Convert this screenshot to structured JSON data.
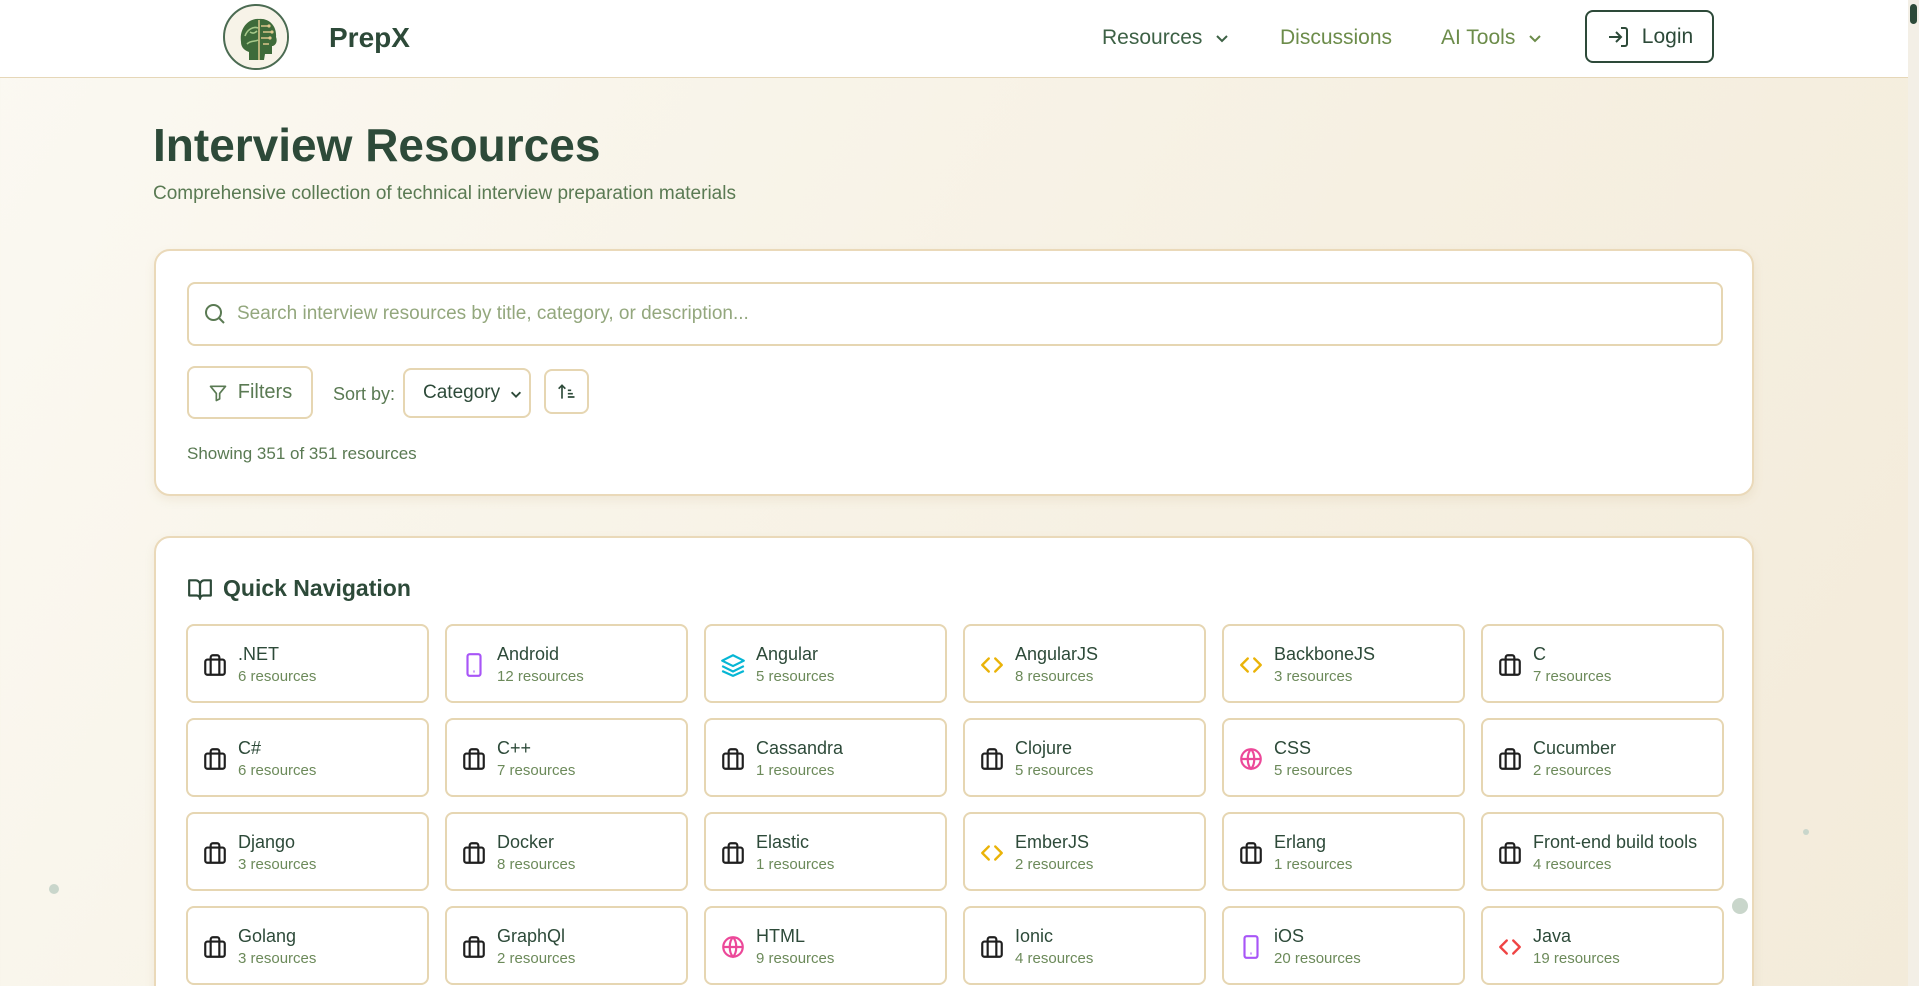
{
  "header": {
    "brand": "PrepX",
    "nav": [
      {
        "label": "Resources",
        "dropdown": true
      },
      {
        "label": "Discussions",
        "dropdown": false
      },
      {
        "label": "AI Tools",
        "dropdown": true
      }
    ],
    "login_label": "Login"
  },
  "page": {
    "title": "Interview Resources",
    "subtitle": "Comprehensive collection of technical interview preparation materials"
  },
  "search": {
    "placeholder": "Search interview resources by title, category, or description...",
    "value": "",
    "filters_label": "Filters",
    "sort_label": "Sort by:",
    "sort_value": "Category",
    "showing": "Showing 351 of 351 resources"
  },
  "quick_nav": {
    "title": "Quick Navigation",
    "items": [
      {
        "name": ".NET",
        "count": "6 resources",
        "icon": "briefcase-icon",
        "color": "#1f1f1f"
      },
      {
        "name": "Android",
        "count": "12 resources",
        "icon": "smartphone-icon",
        "color": "#a855f7"
      },
      {
        "name": "Angular",
        "count": "5 resources",
        "icon": "layers-icon",
        "color": "#06b6d4"
      },
      {
        "name": "AngularJS",
        "count": "8 resources",
        "icon": "code-icon",
        "color": "#eab308"
      },
      {
        "name": "BackboneJS",
        "count": "3 resources",
        "icon": "code-icon",
        "color": "#eab308"
      },
      {
        "name": "C",
        "count": "7 resources",
        "icon": "briefcase-icon",
        "color": "#1f1f1f"
      },
      {
        "name": "C#",
        "count": "6 resources",
        "icon": "briefcase-icon",
        "color": "#1f1f1f"
      },
      {
        "name": "C++",
        "count": "7 resources",
        "icon": "briefcase-icon",
        "color": "#1f1f1f"
      },
      {
        "name": "Cassandra",
        "count": "1 resources",
        "icon": "briefcase-icon",
        "color": "#1f1f1f"
      },
      {
        "name": "Clojure",
        "count": "5 resources",
        "icon": "briefcase-icon",
        "color": "#1f1f1f"
      },
      {
        "name": "CSS",
        "count": "5 resources",
        "icon": "globe-icon",
        "color": "#ec4899"
      },
      {
        "name": "Cucumber",
        "count": "2 resources",
        "icon": "briefcase-icon",
        "color": "#1f1f1f"
      },
      {
        "name": "Django",
        "count": "3 resources",
        "icon": "briefcase-icon",
        "color": "#1f1f1f"
      },
      {
        "name": "Docker",
        "count": "8 resources",
        "icon": "briefcase-icon",
        "color": "#1f1f1f"
      },
      {
        "name": "Elastic",
        "count": "1 resources",
        "icon": "briefcase-icon",
        "color": "#1f1f1f"
      },
      {
        "name": "EmberJS",
        "count": "2 resources",
        "icon": "code-icon",
        "color": "#eab308"
      },
      {
        "name": "Erlang",
        "count": "1 resources",
        "icon": "briefcase-icon",
        "color": "#1f1f1f"
      },
      {
        "name": "Front-end build tools",
        "count": "4 resources",
        "icon": "briefcase-icon",
        "color": "#1f1f1f"
      },
      {
        "name": "Golang",
        "count": "3 resources",
        "icon": "briefcase-icon",
        "color": "#1f1f1f"
      },
      {
        "name": "GraphQl",
        "count": "2 resources",
        "icon": "briefcase-icon",
        "color": "#1f1f1f"
      },
      {
        "name": "HTML",
        "count": "9 resources",
        "icon": "globe-icon",
        "color": "#ec4899"
      },
      {
        "name": "Ionic",
        "count": "4 resources",
        "icon": "briefcase-icon",
        "color": "#1f1f1f"
      },
      {
        "name": "iOS",
        "count": "20 resources",
        "icon": "smartphone-icon",
        "color": "#a855f7"
      },
      {
        "name": "Java",
        "count": "19 resources",
        "icon": "code-icon",
        "color": "#ef4444"
      }
    ]
  }
}
